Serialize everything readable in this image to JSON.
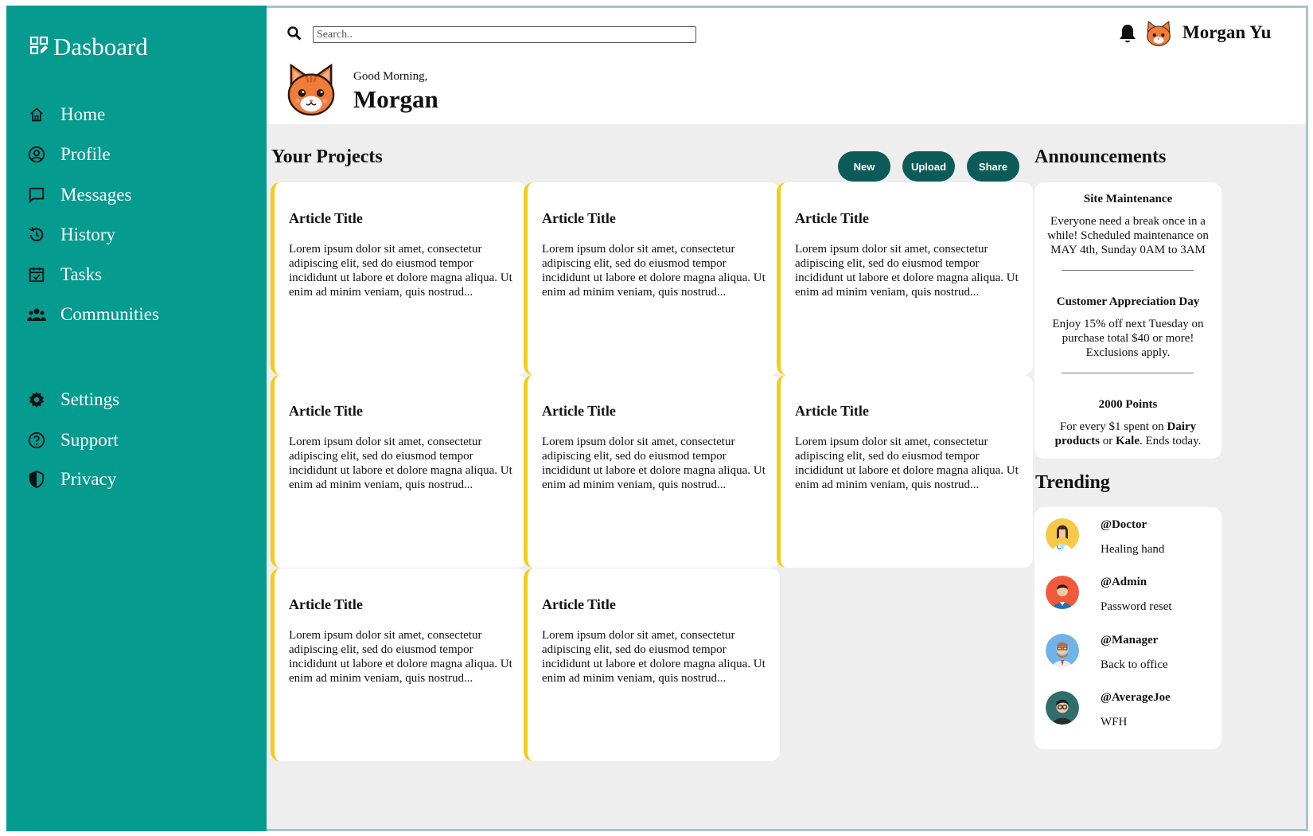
{
  "app": {
    "title": "Dasboard"
  },
  "sidebar": {
    "items": [
      {
        "label": "Home",
        "icon": "home-icon"
      },
      {
        "label": "Profile",
        "icon": "user-circle-icon"
      },
      {
        "label": "Messages",
        "icon": "message-icon"
      },
      {
        "label": "History",
        "icon": "history-icon"
      },
      {
        "label": "Tasks",
        "icon": "calendar-check-icon"
      },
      {
        "label": "Communities",
        "icon": "group-icon"
      },
      {
        "label": "Settings",
        "icon": "gear-icon"
      },
      {
        "label": "Support",
        "icon": "help-circle-icon"
      },
      {
        "label": "Privacy",
        "icon": "shield-icon"
      }
    ]
  },
  "header": {
    "search_placeholder": "Search..",
    "user_name": "Morgan Yu",
    "greeting": "Good Morning,",
    "greeting_name": "Morgan"
  },
  "projects": {
    "title": "Your Projects",
    "buttons": {
      "new": "New",
      "upload": "Upload",
      "share": "Share"
    },
    "cards": [
      {
        "title": "Article Title",
        "body": "Lorem ipsum dolor sit amet, consectetur adipiscing elit, sed do eiusmod tempor incididunt ut labore et dolore magna aliqua. Ut enim ad minim veniam, quis nostrud..."
      },
      {
        "title": "Article Title",
        "body": "Lorem ipsum dolor sit amet, consectetur adipiscing elit, sed do eiusmod tempor incididunt ut labore et dolore magna aliqua. Ut enim ad minim veniam, quis nostrud..."
      },
      {
        "title": "Article Title",
        "body": "Lorem ipsum dolor sit amet, consectetur adipiscing elit, sed do eiusmod tempor incididunt ut labore et dolore magna aliqua. Ut enim ad minim veniam, quis nostrud..."
      },
      {
        "title": "Article Title",
        "body": "Lorem ipsum dolor sit amet, consectetur adipiscing elit, sed do eiusmod tempor incididunt ut labore et dolore magna aliqua. Ut enim ad minim veniam, quis nostrud..."
      },
      {
        "title": "Article Title",
        "body": "Lorem ipsum dolor sit amet, consectetur adipiscing elit, sed do eiusmod tempor incididunt ut labore et dolore magna aliqua. Ut enim ad minim veniam, quis nostrud..."
      },
      {
        "title": "Article Title",
        "body": "Lorem ipsum dolor sit amet, consectetur adipiscing elit, sed do eiusmod tempor incididunt ut labore et dolore magna aliqua. Ut enim ad minim veniam, quis nostrud..."
      },
      {
        "title": "Article Title",
        "body": "Lorem ipsum dolor sit amet, consectetur adipiscing elit, sed do eiusmod tempor incididunt ut labore et dolore magna aliqua. Ut enim ad minim veniam, quis nostrud..."
      },
      {
        "title": "Article Title",
        "body": "Lorem ipsum dolor sit amet, consectetur adipiscing elit, sed do eiusmod tempor incididunt ut labore et dolore magna aliqua. Ut enim ad minim veniam, quis nostrud..."
      }
    ]
  },
  "announcements": {
    "title": "Announcements",
    "items": [
      {
        "title": "Site Maintenance",
        "text": "Everyone need a break once in a while! Scheduled maintenance on MAY 4th, Sunday 0AM to 3AM"
      },
      {
        "title": "Customer Appreciation Day",
        "text": "Enjoy 15% off next Tuesday on purchase total $40 or more! Exclusions apply."
      },
      {
        "title": "2000 Points",
        "text_prefix": "For every $1 spent on ",
        "bold_1": "Dairy products",
        "text_mid": " or ",
        "bold_2": "Kale",
        "text_suffix": ". Ends today."
      }
    ]
  },
  "trending": {
    "title": "Trending",
    "items": [
      {
        "handle": "@Doctor",
        "desc": "Healing hand"
      },
      {
        "handle": "@Admin",
        "desc": "Password reset"
      },
      {
        "handle": "@Manager",
        "desc": "Back to office"
      },
      {
        "handle": "@AverageJoe",
        "desc": "WFH"
      }
    ]
  },
  "colors": {
    "sidebar": "#069b8f",
    "button": "#0d5b59",
    "card_accent": "#f3cd19",
    "background": "#eeeeee"
  }
}
